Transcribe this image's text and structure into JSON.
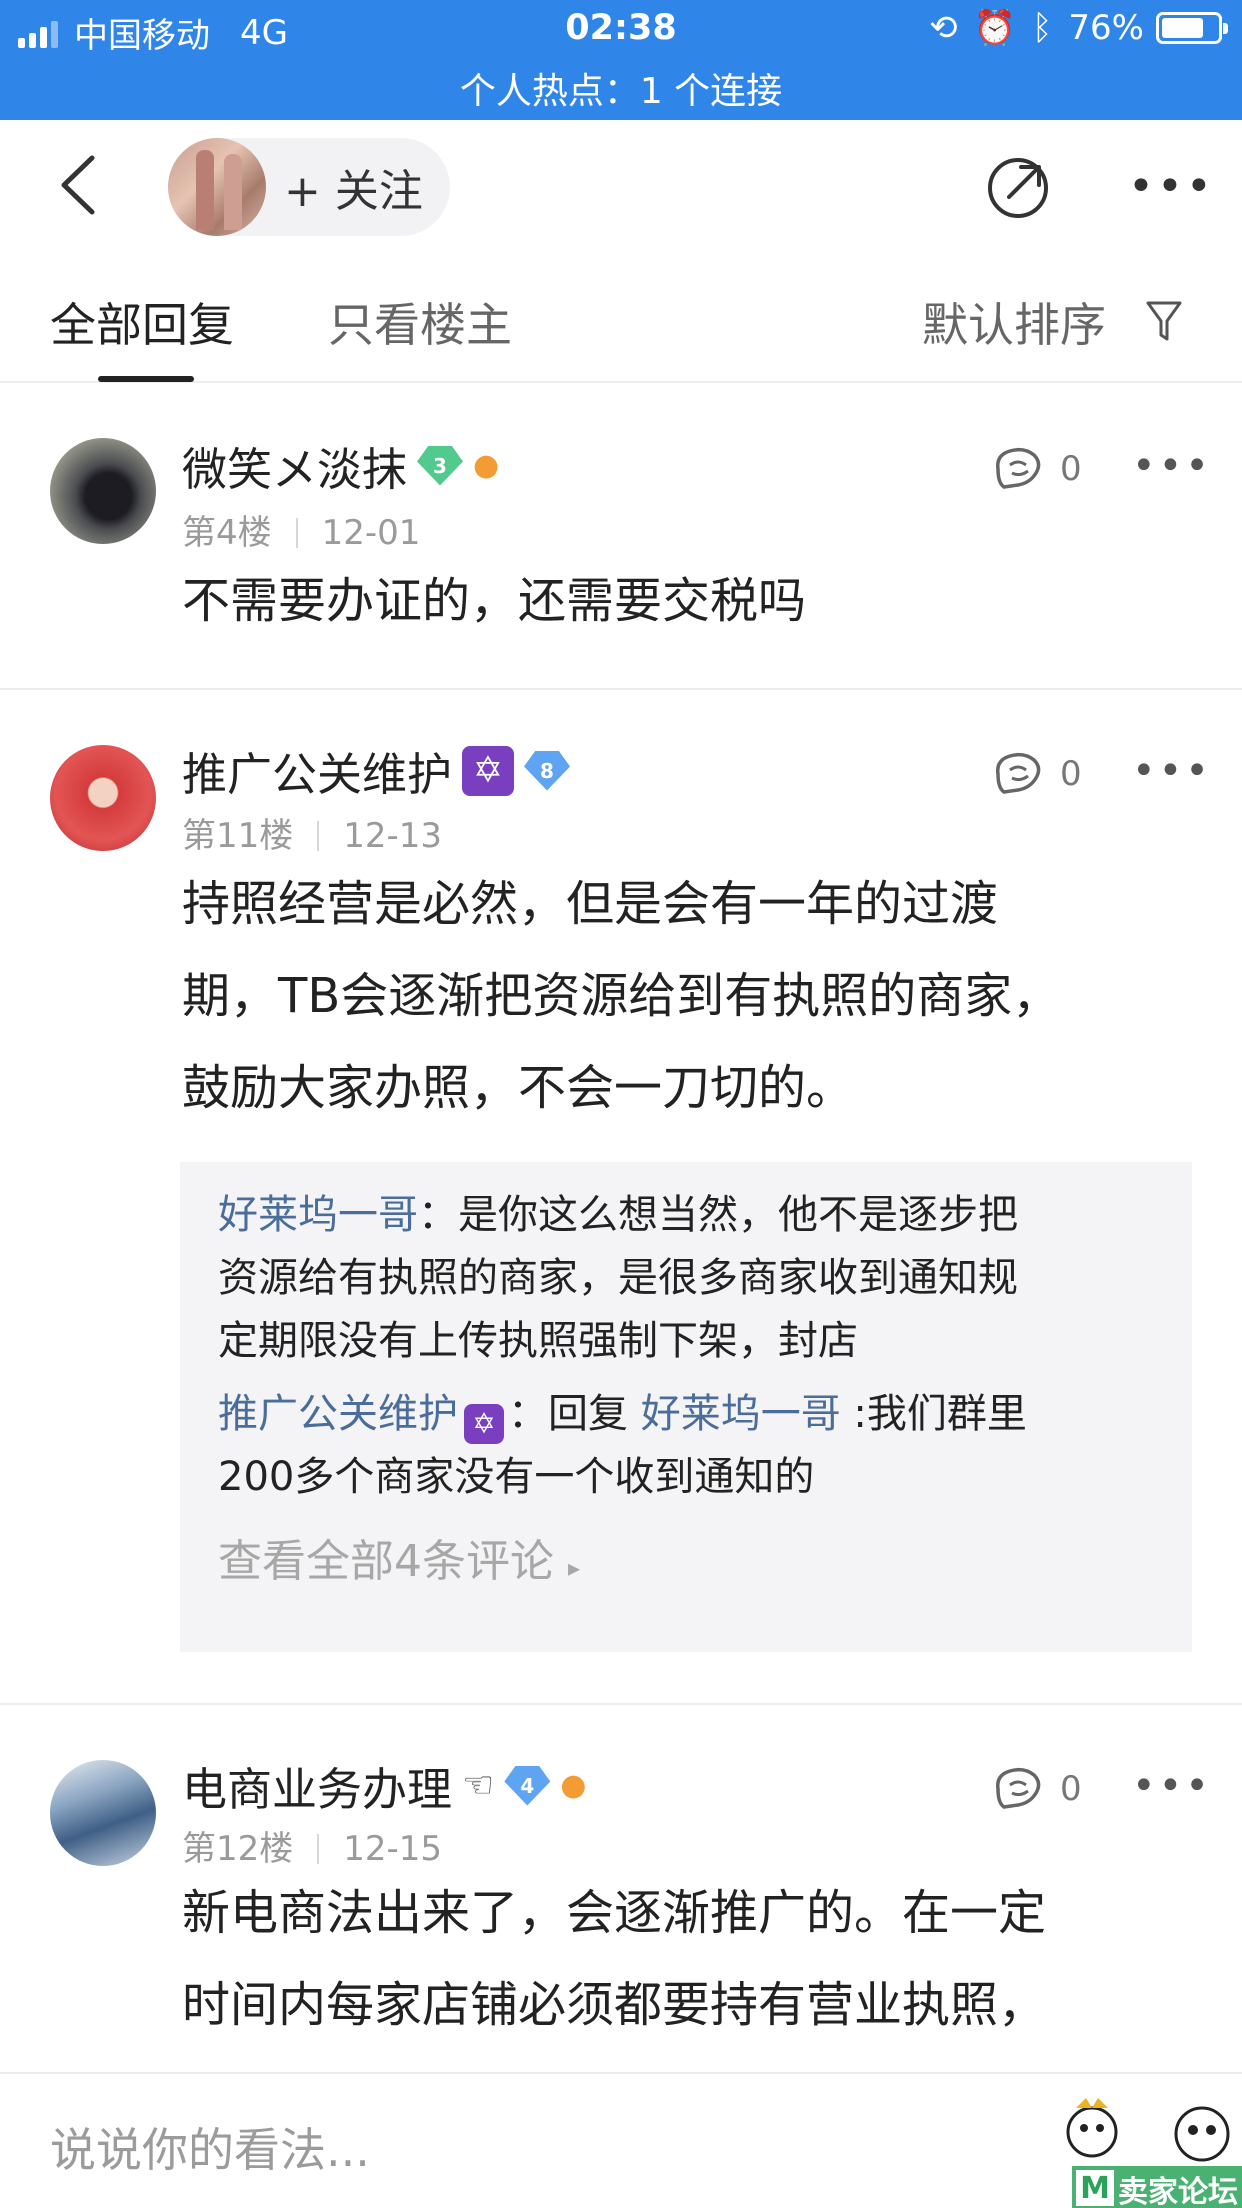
{
  "status_bar": {
    "carrier": "中国移动",
    "network": "4G",
    "time": "02:38",
    "battery": "76%",
    "battery_level": 0.76,
    "hotspot": "个人热点：1 个连接"
  },
  "nav": {
    "follow_label": "+ 关注"
  },
  "tabs": {
    "all": "全部回复",
    "op_only": "只看楼主",
    "sort": "默认排序"
  },
  "posts": [
    {
      "author": "微笑メ淡抹",
      "level": "3",
      "floor": "第4楼",
      "date": "12-01",
      "likes": "0",
      "content": "不需要办证的，还需要交税吗"
    },
    {
      "author": "推广公关维护",
      "level": "8",
      "floor": "第11楼",
      "date": "12-13",
      "likes": "0",
      "content_lines": [
        "持照经营是必然，但是会有一年的过渡",
        "期，TB会逐渐把资源给到有执照的商家，",
        "鼓励大家办照，不会一刀切的。"
      ],
      "replies": [
        {
          "name": "好莱坞一哥",
          "colon": "：",
          "line1": "是你这么想当然，他不是逐步把",
          "line2": "资源给有执照的商家，是很多商家收到通知规",
          "line3": "定期限没有上传执照强制下架，封店"
        },
        {
          "name": "推广公关维护",
          "colon": "：",
          "reply_word": "回复 ",
          "target": "好莱坞一哥",
          "line1": " :我们群里",
          "line2": "200多个商家没有一个收到通知的"
        }
      ],
      "view_all": "查看全部4条评论"
    },
    {
      "author": "电商业务办理",
      "level": "4",
      "floor": "第12楼",
      "date": "12-15",
      "likes": "0",
      "content_lines": [
        "新电商法出来了，会逐渐推广的。在一定",
        "时间内每家店铺必须都要持有营业执照，"
      ]
    }
  ],
  "input": {
    "placeholder": "说说你的看法..."
  },
  "watermark": "卖家论坛 menbie.com",
  "colors": {
    "status_bar": "#2f86e8",
    "reply_name": "#4a6d9a"
  }
}
